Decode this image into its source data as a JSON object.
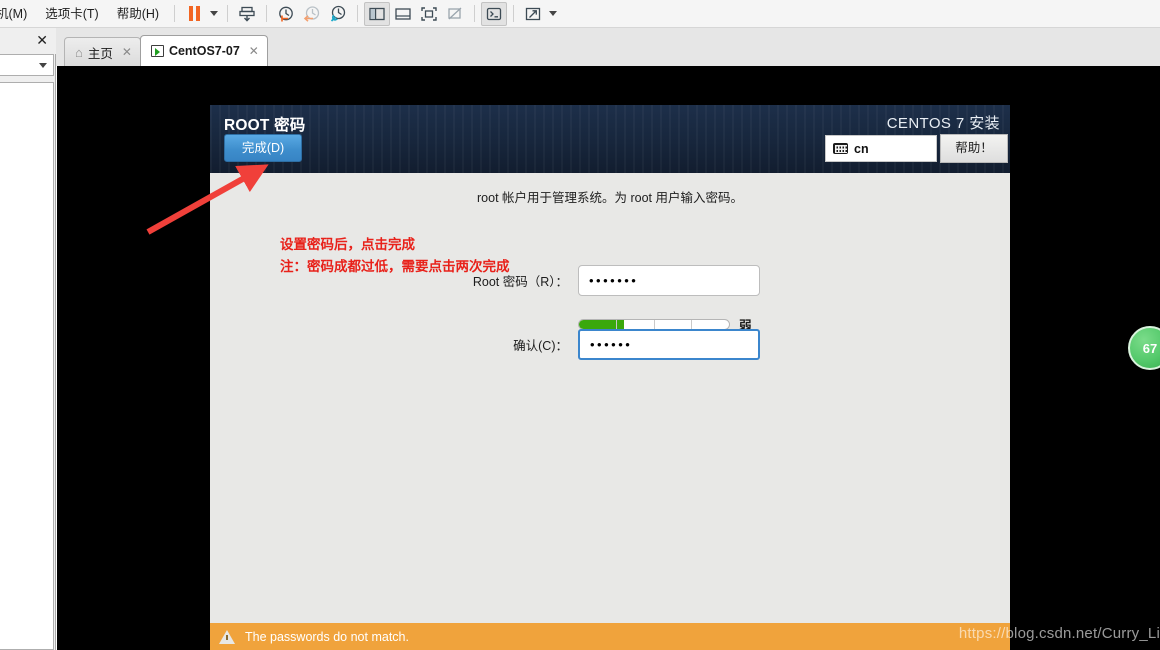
{
  "app": {
    "menus": [
      {
        "label": "机(M)",
        "name": "menu-virtual-machine"
      },
      {
        "label": "选项卡(T)",
        "name": "menu-tabs"
      },
      {
        "label": "帮助(H)",
        "name": "menu-help"
      }
    ],
    "toolbar_icons": [
      {
        "name": "pause-icon",
        "title": "暂停"
      },
      {
        "name": "pause-dropdown-caret-icon",
        "title": "暂停选项"
      },
      {
        "name": "take-snapshot-icon",
        "title": "拍摄此虚拟机的快照"
      },
      {
        "name": "revert-snapshot-icon",
        "title": "恢复到快照"
      },
      {
        "name": "snapshot-back-icon",
        "title": "上一个快照"
      },
      {
        "name": "manage-snapshots-icon",
        "title": "管理快照"
      },
      {
        "name": "show-library-panel-icon",
        "title": "显示或隐藏虚拟机库"
      },
      {
        "name": "show-thumbnail-bar-icon",
        "title": "显示或隐藏缩略图栏"
      },
      {
        "name": "enter-fullscreen-icon",
        "title": "进入全屏模式"
      },
      {
        "name": "unity-mode-icon",
        "title": "Unity 模式"
      },
      {
        "name": "console-view-icon",
        "title": "控制台视图"
      },
      {
        "name": "stretch-guest-icon",
        "title": "拉伸客户机"
      },
      {
        "name": "stretch-dropdown-caret-icon",
        "title": "显示选项"
      }
    ],
    "library": {
      "close_label": "✕",
      "combo_value": ""
    },
    "tabs": [
      {
        "label": "主页",
        "icon": "home-icon",
        "active": false,
        "close": "✕"
      },
      {
        "label": "CentOS7-07",
        "icon": "vm-power-icon",
        "active": true,
        "close": "✕"
      }
    ]
  },
  "installer": {
    "header": {
      "title": "ROOT 密码",
      "done_button": "完成(D)",
      "brand": "CENTOS 7 安装",
      "keyboard_layout": "cn",
      "help_button": "帮助！"
    },
    "body": {
      "intro": "root 帐户用于管理系统。为 root 用户输入密码。",
      "password_label": "Root 密码（R）：",
      "password_value": "•••••••",
      "confirm_label": "确认(C)：",
      "confirm_value": "••••••",
      "strength_label": "弱",
      "strength_percent": 30
    },
    "warning": {
      "text": "The passwords do not match."
    }
  },
  "annotations": {
    "line1": "设置密码后，点击完成",
    "line2": "注：密码成都过低，需要点击两次完成",
    "arrow_color": "#f0403a"
  },
  "overlay": {
    "watermark": "https://blog.csdn.net/Curry_Li",
    "badge_value": "67"
  },
  "colors": {
    "header_blue": "#17263c",
    "done_blue": "#3e8ecd",
    "focus_blue": "#3b86cd",
    "warn_orange": "#f0a33c",
    "meter_green": "#3aa80c",
    "annotation_red": "#e8211a"
  }
}
